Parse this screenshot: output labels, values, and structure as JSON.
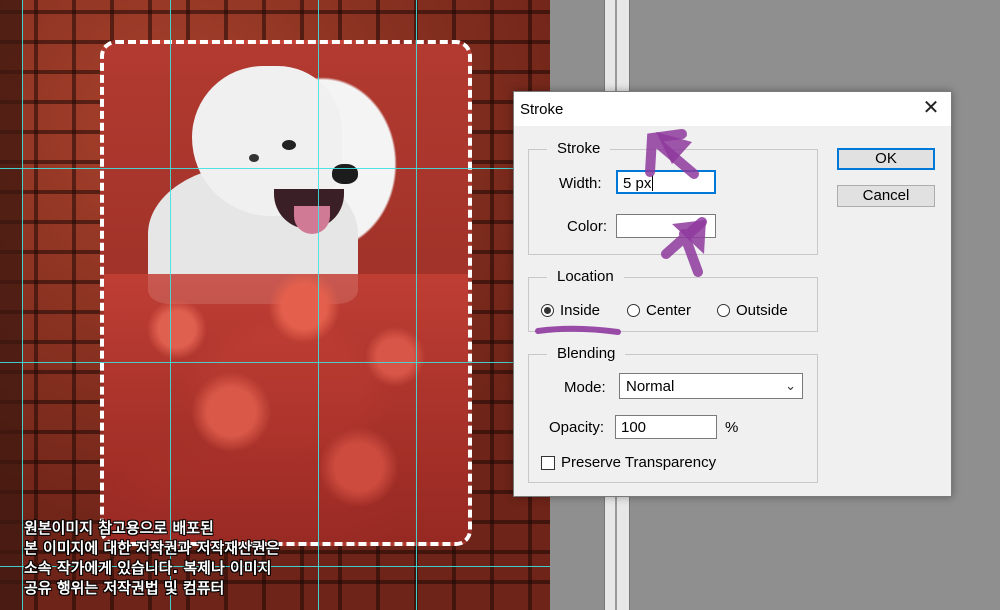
{
  "canvas": {
    "watermark_lines": [
      "원본이미지 참고용으로 배포된",
      "본 이미지에 대한 저작권과 저작재산권은",
      "소속 작가에게 있습니다. 복제나 이미지",
      "공유 행위는 저작권법 및 컴퓨터"
    ]
  },
  "dialog": {
    "title": "Stroke",
    "close_glyph": "✕",
    "stroke_group": {
      "legend": "Stroke",
      "width_label": "Width:",
      "width_value": "5 px",
      "color_label": "Color:",
      "color_value": "#ffffff"
    },
    "location_group": {
      "legend": "Location",
      "options": [
        {
          "label": "Inside",
          "checked": true
        },
        {
          "label": "Center",
          "checked": false
        },
        {
          "label": "Outside",
          "checked": false
        }
      ]
    },
    "blending_group": {
      "legend": "Blending",
      "mode_label": "Mode:",
      "mode_value": "Normal",
      "opacity_label": "Opacity:",
      "opacity_value": "100",
      "opacity_unit": "%",
      "preserve_label": "Preserve Transparency",
      "preserve_checked": false
    },
    "buttons": {
      "ok": "OK",
      "cancel": "Cancel"
    }
  },
  "colors": {
    "accent": "#0078d7",
    "guide": "#3fe0e0",
    "annotation": "#8e3a9e"
  }
}
